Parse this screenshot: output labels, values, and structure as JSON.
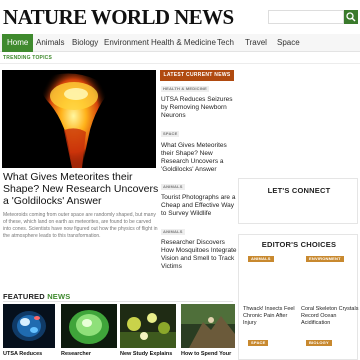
{
  "site": {
    "logo": "NATURE WORLD NEWS"
  },
  "search": {
    "placeholder": ""
  },
  "nav": [
    "Home",
    "Animals",
    "Biology",
    "Environment",
    "Health & Medicine",
    "Tech",
    "Travel",
    "Space"
  ],
  "trending_label": "TRENDING TOPICS",
  "hero": {
    "title": "What Gives Meteorites their Shape? New Research Uncovers a 'Goldilocks' Answer",
    "description": "Meteoroids coming from outer space are randomly shaped, but many of these, which land on earth as meteorites, are found to be carved into cones. Scientists have now figured out how the physics of flight in the atmosphere leads to this transformation."
  },
  "latest": {
    "button": "LATEST CURRENT NEWS",
    "items": [
      {
        "category": "HEALTH & MEDICINE",
        "title": "UTSA Reduces Seizures by Removing Newborn Neurons"
      },
      {
        "category": "SPACE",
        "title": "What Gives Meteorites their Shape? New Research Uncovers a 'Goldilocks' Answer"
      },
      {
        "category": "ANIMALS",
        "title": "Tourist Photographs are a Cheap and Effective Way to Survey Wildlife"
      },
      {
        "category": "ANIMALS",
        "title": "Researcher Discovers How Mosquitoes Integrate Vision and Smell to Track Victims"
      }
    ]
  },
  "connect": {
    "title": "LET'S CONNECT"
  },
  "editors": {
    "title": "EDITOR'S CHOICES",
    "items": [
      {
        "category": "ANIMALS",
        "title": "Thwack! Insects Feel Chronic Pain After Injury"
      },
      {
        "category": "ENVIRONMENT",
        "title": "Coral Skeleton Crystals Record Ocean Acidification"
      },
      {
        "category": "SPACE",
        "title": ""
      },
      {
        "category": "BIOLOGY",
        "title": ""
      }
    ]
  },
  "featured": {
    "label_a": "FEATURED",
    "label_b": "NEWS",
    "items": [
      {
        "caption": "UTSA Reduces"
      },
      {
        "caption": "Researcher"
      },
      {
        "caption": "New Study Explains"
      },
      {
        "caption": "How to Spend Your"
      }
    ]
  },
  "colors": {
    "brand_green": "#3f8a2e",
    "latest_orange": "#b04a10",
    "editor_badge": "#c8892f"
  }
}
